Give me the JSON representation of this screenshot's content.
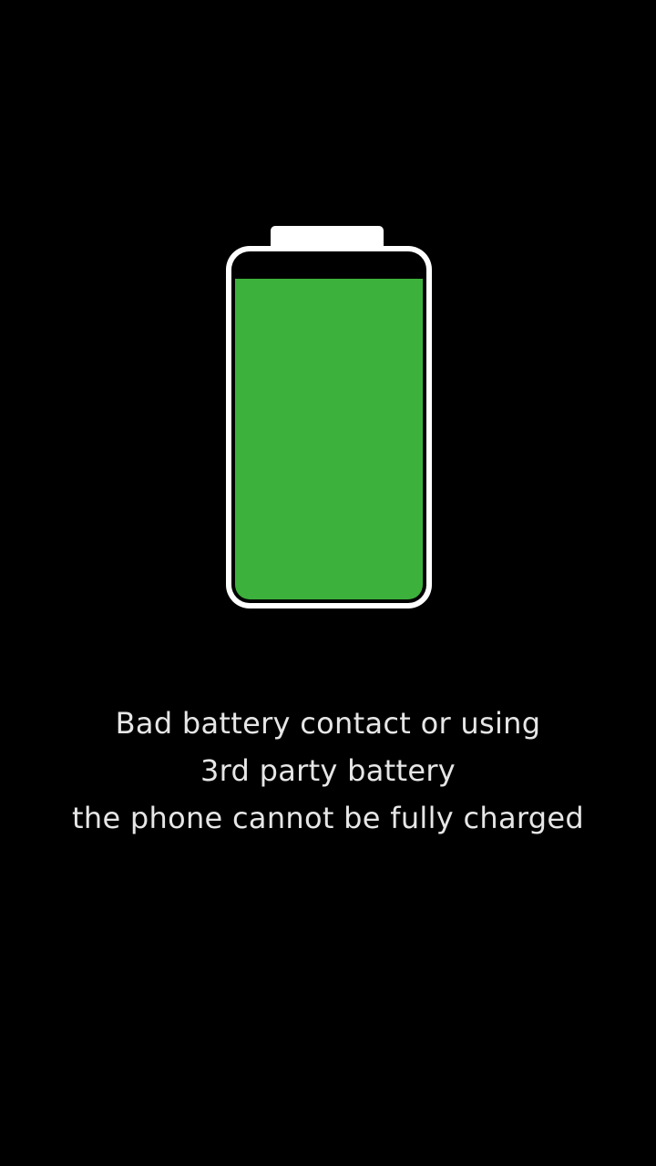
{
  "battery": {
    "icon": "battery-icon",
    "fill_fraction": 0.93,
    "fill_color": "#3cb13c",
    "outline_color": "#ffffff"
  },
  "message": {
    "lines": [
      "Bad battery contact or using",
      "3rd party battery",
      "the phone cannot be fully charged"
    ]
  }
}
